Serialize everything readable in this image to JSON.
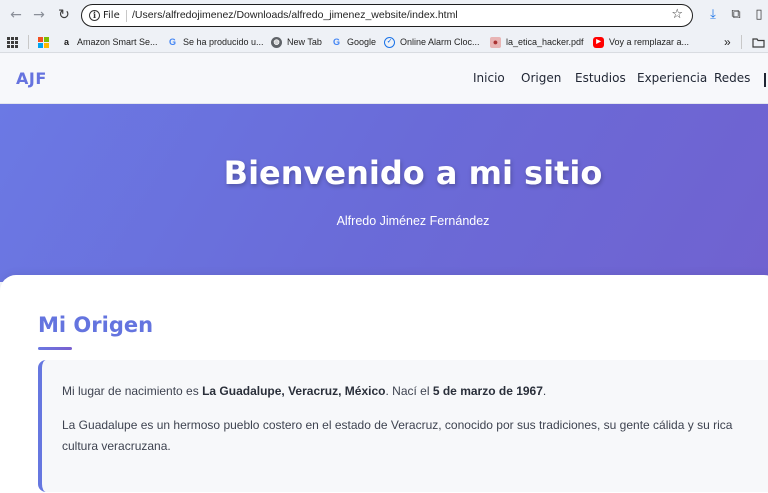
{
  "browser": {
    "file_label": "File",
    "url": "/Users/alfredojimenez/Downloads/alfredo_jimenez_website/index.html"
  },
  "bookmarks": [
    {
      "label": "Amazon Smart Se...",
      "icon": "amazon-icon",
      "color": "#1a1a1a"
    },
    {
      "label": "Se ha producido u...",
      "icon": "google-icon",
      "color": "#4285f4"
    },
    {
      "label": "New Tab",
      "icon": "globe-icon",
      "color": "#5f6368"
    },
    {
      "label": "Google",
      "icon": "google-icon",
      "color": "#4285f4"
    },
    {
      "label": "Online Alarm Cloc...",
      "icon": "alarm-clock-icon",
      "color": "#1a73e8"
    },
    {
      "label": "la_etica_hacker.pdf",
      "icon": "pdf-icon",
      "color": "#c44"
    },
    {
      "label": "Voy a remplazar a...",
      "icon": "youtube-icon",
      "color": "#ff0000"
    }
  ],
  "site": {
    "logo": "AJF",
    "nav": [
      "Inicio",
      "Origen",
      "Estudios",
      "Experiencia",
      "Redes"
    ],
    "accent_color": "#6474df"
  },
  "hero": {
    "title": "Bienvenido a mi sitio",
    "subtitle": "Alfredo Jiménez Fernández"
  },
  "origen": {
    "title": "Mi Origen",
    "p1_pre": "Mi lugar de nacimiento es ",
    "p1_place": "La Guadalupe, Veracruz, México",
    "p1_mid": ". Nací el ",
    "p1_date": "5 de marzo de 1967",
    "p1_end": ".",
    "p2_line1": "La Guadalupe es un hermoso pueblo costero en el estado de Veracruz, conocido por sus tradiciones, su gente cálida y su rica",
    "p2_line2": "cultura veracruzana."
  }
}
